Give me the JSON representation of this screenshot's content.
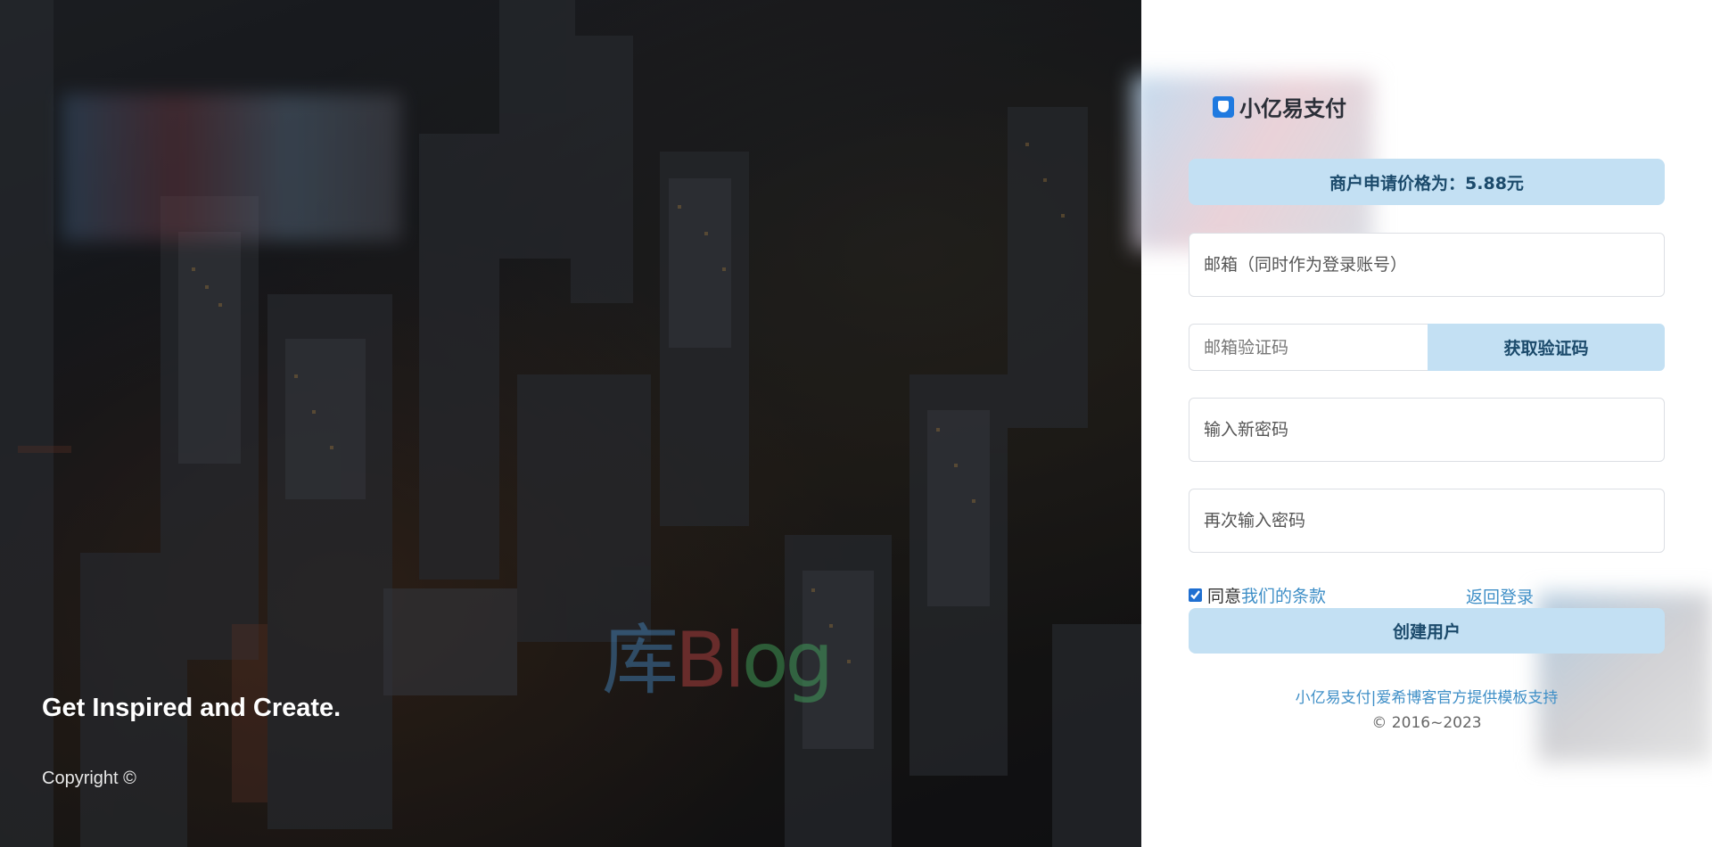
{
  "left": {
    "tagline": "Get Inspired and Create.",
    "copyright": "Copyright ©",
    "watermark": {
      "part1": "库",
      "part2": "Bl",
      "part3": "og"
    }
  },
  "brand": {
    "name": "小亿易支付",
    "logo_icon": "shield-wallet-icon",
    "logo_color": "#1f7ae0"
  },
  "price_banner": {
    "text": "商户申请价格为：5.88元"
  },
  "form": {
    "email_placeholder": "邮箱（同时作为登录账号）",
    "code_placeholder": "邮箱验证码",
    "get_code_label": "获取验证码",
    "password_placeholder": "输入新密码",
    "password_confirm_placeholder": "再次输入密码",
    "agree_prefix": "同意",
    "terms_link": "我们的条款",
    "agree_checked": true,
    "back_to_login": "返回登录",
    "create_button": "创建用户"
  },
  "footer": {
    "link1": "小亿易支付",
    "separator": "|",
    "link2": "爱希博客官方提供模板支持",
    "copyright": "© 2016~2023"
  },
  "colors": {
    "accent_bg": "#c3e0f3",
    "accent_text": "#1b4a6b",
    "link": "#3f8fc7"
  }
}
